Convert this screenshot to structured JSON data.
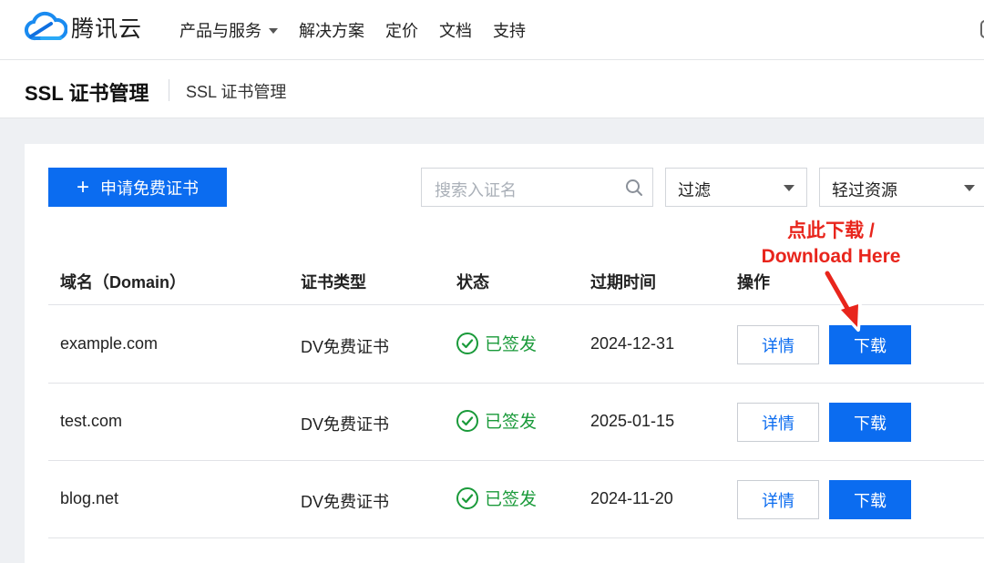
{
  "topnav": {
    "brand": "腾讯云",
    "items": [
      {
        "label": "产品与服务",
        "dropdown": true
      },
      {
        "label": "解决方案"
      },
      {
        "label": "定价"
      },
      {
        "label": "文档"
      },
      {
        "label": "支持"
      }
    ]
  },
  "page_header": {
    "title": "SSL 证书管理",
    "subtitle": "SSL 证书管理"
  },
  "toolbar": {
    "apply_button": "申请免费证书",
    "search_placeholder": "搜索入证名",
    "filter_value": "过滤",
    "resource_value": "轻过资源"
  },
  "table": {
    "columns": [
      "域名（Domain）",
      "证书类型",
      "状态",
      "过期时间",
      "操作"
    ],
    "rows": [
      {
        "domain": "example.com",
        "type": "DV免费证书",
        "status": "已签发",
        "expiry": "2024-12-31",
        "detail": "详情",
        "download": "下载"
      },
      {
        "domain": "test.com",
        "type": "DV免费证书",
        "status": "已签发",
        "expiry": "2025-01-15",
        "detail": "详情",
        "download": "下载"
      },
      {
        "domain": "blog.net",
        "type": "DV免费证书",
        "status": "已签发",
        "expiry": "2024-11-20",
        "detail": "详情",
        "download": "下载"
      }
    ]
  },
  "annotation": {
    "line1": "点此下载 /",
    "line2": "Download Here"
  },
  "colors": {
    "primary": "#0b6cf0",
    "success": "#1a9a3a",
    "annotation": "#e8251c"
  },
  "icons": [
    "tencent-cloud-logo",
    "plus-icon",
    "search-icon",
    "chevron-down-icon",
    "check-circle-icon",
    "arrow-icon"
  ]
}
